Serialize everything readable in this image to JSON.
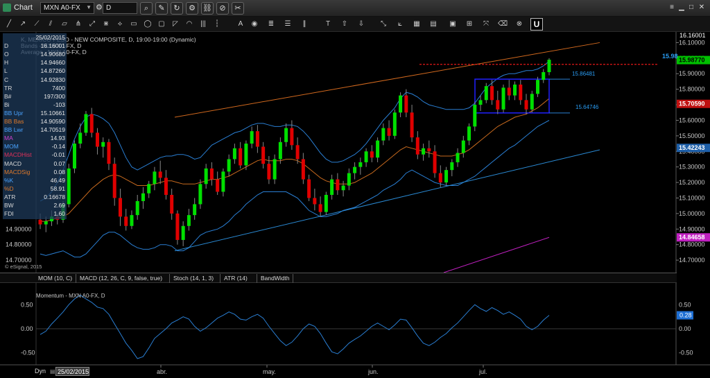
{
  "window": {
    "title": "Chart"
  },
  "toolbar": {
    "symbol": "MXN A0-FX",
    "interval": "D"
  },
  "legend": {
    "line1": "K, MEXICO PESO - NEW COMPOSITE, D, 19:00-19:00 (Dynamic)",
    "line2": "Bands - MXN A0-FX, D",
    "line3": "Average - MXN A0-FX, D"
  },
  "data_window": [
    {
      "label": "",
      "value": "25/02/2015"
    },
    {
      "label": "D",
      "value": "16.16001"
    },
    {
      "label": "O",
      "value": "14.90680"
    },
    {
      "label": "H",
      "value": "14.94660"
    },
    {
      "label": "L",
      "value": "14.87260"
    },
    {
      "label": "C",
      "value": "14.92830"
    },
    {
      "label": "TR",
      "value": "7400"
    },
    {
      "label": "B#",
      "value": "197/300"
    },
    {
      "label": "Bi",
      "value": "-103"
    },
    {
      "label": "BB Upr",
      "value": "15.10661"
    },
    {
      "label": "BB Bas",
      "value": "14.90590"
    },
    {
      "label": "BB Lwr",
      "value": "14.70519"
    },
    {
      "label": "MA",
      "value": "14.93"
    },
    {
      "label": "MOM",
      "value": "-0.14"
    },
    {
      "label": "MACDHist",
      "value": "-0.01"
    },
    {
      "label": "MACD",
      "value": "0.07"
    },
    {
      "label": "MACDSig",
      "value": "0.08"
    },
    {
      "label": "%K",
      "value": "46.49"
    },
    {
      "label": "%D",
      "value": "58.91"
    },
    {
      "label": "ATR",
      "value": "0.16678"
    },
    {
      "label": "BW",
      "value": "2.69"
    },
    {
      "label": "FDI",
      "value": "1.60"
    }
  ],
  "price_axis": {
    "ticks": [
      "16.10000",
      "16.00000",
      "15.90000",
      "15.80000",
      "15.70000",
      "15.60000",
      "15.50000",
      "15.40000",
      "15.30000",
      "15.20000",
      "15.10000",
      "15.00000",
      "14.90000",
      "14.80000",
      "14.70000"
    ],
    "top_label": "16.16001",
    "last_price": "15.98770",
    "edge_label": "15.98",
    "tag_ma": "15.70590",
    "tag_lower": "15.42243",
    "tag_magenta": "14.84658",
    "box_top_label": "15.86481",
    "box_bottom_label": "15.64746"
  },
  "left_axis_labels": [
    "14.90000",
    "14.80000",
    "14.70000"
  ],
  "copyright": "© eSignal, 2015",
  "tabs": [
    "MOM (10, C)",
    "MACD (12, 26, C, 9, false, true)",
    "Stoch (14, 1, 3)",
    "ATR (14)",
    "BandWidth"
  ],
  "momentum": {
    "title": "Momentum - MXN A0-FX, D",
    "ticks": [
      "0.50",
      "0.00",
      "-0.50"
    ],
    "last_value": "0.28"
  },
  "time_axis": {
    "labels": [
      "abr.",
      "may.",
      "jun.",
      "jul."
    ]
  },
  "footer": {
    "mode": "Dyn",
    "date": "25/02/2015"
  },
  "colors": {
    "up": "#00e000",
    "down": "#e00000",
    "band": "#2a7fd4",
    "ma": "#c86a1e",
    "trend_upper": "#d2691e",
    "trend_lower": "#2a8ad4",
    "resistance": "#ff1a1a",
    "box": "#2020ff",
    "magenta": "#c020c0",
    "last_price_bg": "#00c000",
    "ma_tag_bg": "#c01010"
  },
  "chart_data": [
    {
      "type": "candlestick",
      "title": "MEXICO PESO - NEW COMPOSITE, D",
      "x_labels": [
        "abr.",
        "may.",
        "jun.",
        "jul."
      ],
      "ylim": [
        14.62,
        16.16
      ],
      "ohlc": [
        [
          14.96,
          15.0,
          14.9,
          14.93
        ],
        [
          14.93,
          14.98,
          14.88,
          14.95
        ],
        [
          14.95,
          15.02,
          14.92,
          14.98
        ],
        [
          14.98,
          15.0,
          14.93,
          14.96
        ],
        [
          14.96,
          15.08,
          14.94,
          15.06
        ],
        [
          15.06,
          15.32,
          15.04,
          15.29
        ],
        [
          15.29,
          15.47,
          15.26,
          15.45
        ],
        [
          15.45,
          15.58,
          15.42,
          15.52
        ],
        [
          15.52,
          15.66,
          15.5,
          15.64
        ],
        [
          15.64,
          15.68,
          15.49,
          15.52
        ],
        [
          15.52,
          15.55,
          15.38,
          15.43
        ],
        [
          15.43,
          15.49,
          15.36,
          15.46
        ],
        [
          15.46,
          15.48,
          15.28,
          15.32
        ],
        [
          15.32,
          15.36,
          15.05,
          15.1
        ],
        [
          15.1,
          15.16,
          14.92,
          14.98
        ],
        [
          14.98,
          15.03,
          14.89,
          14.92
        ],
        [
          14.92,
          15.02,
          14.9,
          14.99
        ],
        [
          14.99,
          15.12,
          14.96,
          15.08
        ],
        [
          15.08,
          15.17,
          15.03,
          15.13
        ],
        [
          15.13,
          15.21,
          15.1,
          15.19
        ],
        [
          15.19,
          15.3,
          15.15,
          15.27
        ],
        [
          15.27,
          15.34,
          15.19,
          15.23
        ],
        [
          15.23,
          15.28,
          15.09,
          15.12
        ],
        [
          15.12,
          15.16,
          14.96,
          15.0
        ],
        [
          15.0,
          15.02,
          14.8,
          14.83
        ],
        [
          14.83,
          14.95,
          14.79,
          14.92
        ],
        [
          14.92,
          15.03,
          14.89,
          14.99
        ],
        [
          14.99,
          15.1,
          14.96,
          15.06
        ],
        [
          15.06,
          15.22,
          15.03,
          15.19
        ],
        [
          15.19,
          15.32,
          15.16,
          15.29
        ],
        [
          15.29,
          15.33,
          15.18,
          15.22
        ],
        [
          15.22,
          15.27,
          15.12,
          15.14
        ],
        [
          15.14,
          15.29,
          15.11,
          15.27
        ],
        [
          15.27,
          15.38,
          15.24,
          15.35
        ],
        [
          15.35,
          15.45,
          15.32,
          15.42
        ],
        [
          15.42,
          15.46,
          15.29,
          15.31
        ],
        [
          15.31,
          15.47,
          15.28,
          15.45
        ],
        [
          15.45,
          15.56,
          15.42,
          15.53
        ],
        [
          15.53,
          15.57,
          15.39,
          15.43
        ],
        [
          15.43,
          15.46,
          15.29,
          15.32
        ],
        [
          15.32,
          15.37,
          15.19,
          15.22
        ],
        [
          15.22,
          15.38,
          15.19,
          15.35
        ],
        [
          15.35,
          15.49,
          15.32,
          15.46
        ],
        [
          15.46,
          15.58,
          15.43,
          15.55
        ],
        [
          15.55,
          15.6,
          15.41,
          15.44
        ],
        [
          15.44,
          15.49,
          15.32,
          15.35
        ],
        [
          15.35,
          15.39,
          15.19,
          15.22
        ],
        [
          15.22,
          15.25,
          15.08,
          15.1
        ],
        [
          15.1,
          15.16,
          15.02,
          15.06
        ],
        [
          15.06,
          15.11,
          14.98,
          15.01
        ],
        [
          15.01,
          15.14,
          14.99,
          15.12
        ],
        [
          15.12,
          15.25,
          15.09,
          15.22
        ],
        [
          15.22,
          15.26,
          15.12,
          15.15
        ],
        [
          15.15,
          15.21,
          15.11,
          15.18
        ],
        [
          15.18,
          15.29,
          15.15,
          15.26
        ],
        [
          15.26,
          15.33,
          15.22,
          15.3
        ],
        [
          15.3,
          15.36,
          15.25,
          15.33
        ],
        [
          15.33,
          15.42,
          15.3,
          15.4
        ],
        [
          15.4,
          15.44,
          15.33,
          15.36
        ],
        [
          15.36,
          15.49,
          15.33,
          15.47
        ],
        [
          15.47,
          15.58,
          15.44,
          15.55
        ],
        [
          15.55,
          15.6,
          15.47,
          15.5
        ],
        [
          15.5,
          15.67,
          15.48,
          15.65
        ],
        [
          15.65,
          15.78,
          15.62,
          15.76
        ],
        [
          15.76,
          15.8,
          15.62,
          15.65
        ],
        [
          15.65,
          15.7,
          15.46,
          15.49
        ],
        [
          15.49,
          15.53,
          15.35,
          15.38
        ],
        [
          15.38,
          15.45,
          15.34,
          15.42
        ],
        [
          15.42,
          15.47,
          15.36,
          15.4
        ],
        [
          15.4,
          15.44,
          15.23,
          15.26
        ],
        [
          15.26,
          15.31,
          15.17,
          15.2
        ],
        [
          15.2,
          15.3,
          15.18,
          15.28
        ],
        [
          15.28,
          15.35,
          15.24,
          15.33
        ],
        [
          15.33,
          15.42,
          15.3,
          15.39
        ],
        [
          15.39,
          15.5,
          15.36,
          15.47
        ],
        [
          15.47,
          15.58,
          15.44,
          15.56
        ],
        [
          15.56,
          15.72,
          15.53,
          15.7
        ],
        [
          15.7,
          15.76,
          15.66,
          15.73
        ],
        [
          15.73,
          15.84,
          15.71,
          15.82
        ],
        [
          15.82,
          15.86,
          15.7,
          15.73
        ],
        [
          15.73,
          15.79,
          15.64,
          15.67
        ],
        [
          15.67,
          15.83,
          15.65,
          15.81
        ],
        [
          15.81,
          15.86,
          15.73,
          15.76
        ],
        [
          15.76,
          15.85,
          15.73,
          15.83
        ],
        [
          15.83,
          15.86,
          15.7,
          15.73
        ],
        [
          15.73,
          15.77,
          15.64,
          15.67
        ],
        [
          15.67,
          15.79,
          15.65,
          15.77
        ],
        [
          15.77,
          15.88,
          15.75,
          15.86
        ],
        [
          15.86,
          15.93,
          15.84,
          15.91
        ],
        [
          15.91,
          16.0,
          15.89,
          15.99
        ]
      ],
      "bollinger_upper": [
        15.08,
        15.1,
        15.14,
        15.2,
        15.28,
        15.38,
        15.48,
        15.56,
        15.62,
        15.64,
        15.63,
        15.61,
        15.58,
        15.52,
        15.44,
        15.36,
        15.3,
        15.28,
        15.3,
        15.32,
        15.34,
        15.36,
        15.37,
        15.37,
        15.38,
        15.38,
        15.37,
        15.35,
        15.36,
        15.4,
        15.44,
        15.46,
        15.48,
        15.5,
        15.52,
        15.53,
        15.55,
        15.57,
        15.58,
        15.58,
        15.57,
        15.56,
        15.56,
        15.57,
        15.57,
        15.56,
        15.53,
        15.49,
        15.44,
        15.39,
        15.35,
        15.33,
        15.33,
        15.34,
        15.36,
        15.38,
        15.41,
        15.45,
        15.5,
        15.55,
        15.6,
        15.64,
        15.68,
        15.74,
        15.78,
        15.77,
        15.75,
        15.72,
        15.7,
        15.69,
        15.68,
        15.67,
        15.67,
        15.67,
        15.67,
        15.68,
        15.71,
        15.76,
        15.81,
        15.84,
        15.87,
        15.89,
        15.9,
        15.9,
        15.91,
        15.92,
        15.92,
        15.93,
        15.95,
        15.98
      ],
      "bollinger_lower": [
        14.74,
        14.73,
        14.74,
        14.75,
        14.76,
        14.74,
        14.72,
        14.72,
        14.74,
        14.78,
        14.82,
        14.86,
        14.88,
        14.88,
        14.86,
        14.83,
        14.8,
        14.78,
        14.77,
        14.77,
        14.78,
        14.8,
        14.8,
        14.79,
        14.76,
        14.76,
        14.78,
        14.82,
        14.86,
        14.88,
        14.89,
        14.9,
        14.92,
        14.95,
        14.99,
        15.02,
        15.06,
        15.09,
        15.12,
        15.14,
        15.14,
        15.14,
        15.14,
        15.14,
        15.12,
        15.1,
        15.06,
        15.02,
        15.0,
        14.98,
        14.98,
        14.99,
        15.0,
        15.02,
        15.03,
        15.04,
        15.06,
        15.08,
        15.1,
        15.12,
        15.15,
        15.17,
        15.19,
        15.22,
        15.26,
        15.28,
        15.26,
        15.24,
        15.22,
        15.2,
        15.19,
        15.18,
        15.18,
        15.18,
        15.2,
        15.22,
        15.24,
        15.27,
        15.3,
        15.33,
        15.36,
        15.39,
        15.42,
        15.44,
        15.47,
        15.5,
        15.53,
        15.56,
        15.58,
        15.6
      ],
      "moving_average": [
        14.95,
        14.95,
        14.96,
        14.97,
        14.98,
        15.0,
        15.04,
        15.08,
        15.12,
        15.16,
        15.19,
        15.22,
        15.24,
        15.25,
        15.24,
        15.22,
        15.2,
        15.18,
        15.18,
        15.18,
        15.19,
        15.2,
        15.21,
        15.21,
        15.2,
        15.19,
        15.19,
        15.19,
        15.2,
        15.21,
        15.22,
        15.22,
        15.23,
        15.24,
        15.26,
        15.28,
        15.3,
        15.32,
        15.34,
        15.35,
        15.34,
        15.34,
        15.34,
        15.35,
        15.35,
        15.34,
        15.32,
        15.29,
        15.26,
        15.23,
        15.21,
        15.2,
        15.19,
        15.19,
        15.19,
        15.2,
        15.22,
        15.24,
        15.26,
        15.29,
        15.32,
        15.35,
        15.38,
        15.41,
        15.43,
        15.42,
        15.41,
        15.4,
        15.39,
        15.38,
        15.37,
        15.37,
        15.37,
        15.38,
        15.39,
        15.41,
        15.44,
        15.47,
        15.5,
        15.53,
        15.56,
        15.58,
        15.6,
        15.62,
        15.63,
        15.64,
        15.66,
        15.68,
        15.71,
        15.74
      ],
      "annotations": {
        "resistance_level": 15.96,
        "range_box": [
          15.64746,
          15.86481
        ]
      }
    },
    {
      "type": "line",
      "title": "Momentum - MXN A0-FX, D",
      "ylim": [
        -0.75,
        0.75
      ],
      "values": [
        -0.12,
        -0.05,
        0.1,
        0.22,
        0.35,
        0.5,
        0.62,
        0.7,
        0.62,
        0.55,
        0.45,
        0.42,
        0.3,
        0.1,
        -0.1,
        -0.3,
        -0.45,
        -0.62,
        -0.58,
        -0.4,
        -0.2,
        -0.1,
        0.0,
        0.12,
        0.18,
        0.25,
        0.2,
        0.05,
        -0.05,
        0.02,
        0.12,
        0.22,
        0.28,
        0.35,
        0.3,
        0.2,
        0.18,
        0.25,
        0.3,
        0.22,
        0.05,
        -0.1,
        -0.25,
        -0.35,
        -0.28,
        -0.15,
        0.0,
        0.1,
        0.05,
        -0.1,
        -0.3,
        -0.48,
        -0.52,
        -0.42,
        -0.3,
        -0.22,
        -0.15,
        -0.05,
        0.05,
        0.12,
        0.05,
        -0.02,
        0.08,
        0.2,
        0.18,
        0.02,
        -0.15,
        -0.3,
        -0.35,
        -0.28,
        -0.18,
        -0.1,
        0.02,
        0.12,
        0.25,
        0.38,
        0.5,
        0.42,
        0.36,
        0.44,
        0.38,
        0.3,
        0.35,
        0.28,
        0.2,
        0.05,
        -0.02,
        0.05,
        0.18,
        0.28
      ]
    }
  ]
}
